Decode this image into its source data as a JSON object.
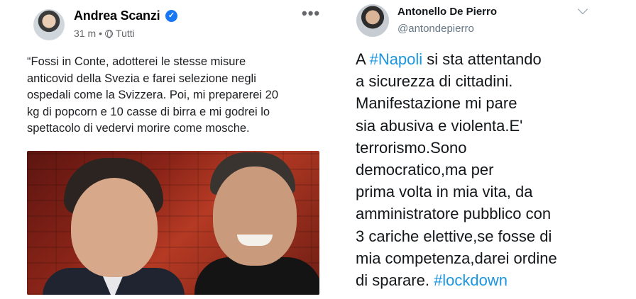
{
  "facebook_post": {
    "author": "Andrea Scanzi",
    "verified_icon": "verified-badge-icon",
    "time": "31 m",
    "separator": "•",
    "audience": "Tutti",
    "audience_icon": "globe-icon",
    "more_icon": "more-options-icon",
    "more_label": "•••",
    "text_lines": [
      "“Fossi in Conte, adotterei le stesse misure",
      "anticovid della Svezia e farei selezione negli",
      "ospedali come la Svizzera. Poi, mi preparerei 20",
      "kg di popcorn e 10 casse di birra e mi godrei lo",
      "spettacolo di vedervi morire come mosche."
    ],
    "verified_color": "#1877f2"
  },
  "tweet": {
    "author": "Antonello De Pierro",
    "handle": "@antondepierro",
    "menu_icon": "chevron-down-icon",
    "link_color": "#1b95e0",
    "lines": [
      {
        "pre": "A ",
        "tag": "#Napoli",
        "post": " si sta attentando"
      },
      {
        "pre": "a sicurezza di cittadini.",
        "tag": "",
        "post": ""
      },
      {
        "pre": "Manifestazione mi pare",
        "tag": "",
        "post": ""
      },
      {
        "pre": "sia abusiva e violenta.E'",
        "tag": "",
        "post": ""
      },
      {
        "pre": "terrorismo.Sono",
        "tag": "",
        "post": ""
      },
      {
        "pre": "democratico,ma per",
        "tag": "",
        "post": ""
      },
      {
        "pre": "prima volta in mia vita, da",
        "tag": "",
        "post": ""
      },
      {
        "pre": "amministratore pubblico con",
        "tag": "",
        "post": ""
      },
      {
        "pre": "3 cariche elettive,se fosse di",
        "tag": "",
        "post": ""
      },
      {
        "pre": "mia competenza,darei ordine",
        "tag": "",
        "post": ""
      },
      {
        "pre": "di sparare. ",
        "tag": "#lockdown",
        "post": ""
      }
    ]
  }
}
